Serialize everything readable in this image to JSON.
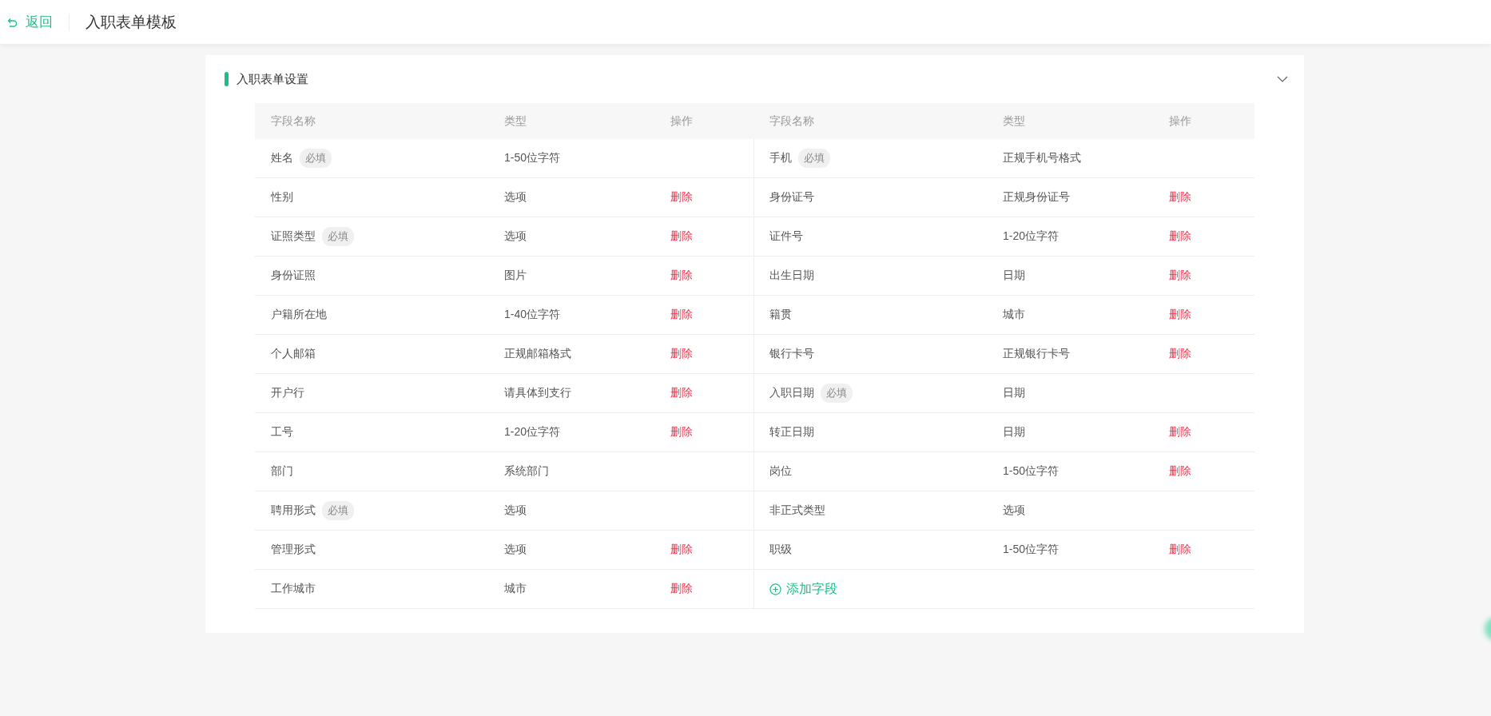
{
  "header": {
    "back": "返回",
    "title": "入职表单模板"
  },
  "section": {
    "title": "入职表单设置",
    "expanded": true
  },
  "table": {
    "columns": [
      "字段名称",
      "类型",
      "操作",
      "字段名称",
      "类型",
      "操作"
    ],
    "rows": [
      {
        "left": {
          "name": "姓名",
          "tag": "必填",
          "type": "1-50位字符"
        },
        "right": {
          "name": "手机",
          "tag": "必填",
          "type": "正规手机号格式"
        }
      },
      {
        "left": {
          "name": "性别",
          "type": "选项",
          "action": "删除"
        },
        "right": {
          "name": "身份证号",
          "type": "正规身份证号",
          "action": "删除"
        }
      },
      {
        "left": {
          "name": "证照类型",
          "tag": "必填",
          "type": "选项",
          "action": "删除"
        },
        "right": {
          "name": "证件号",
          "type": "1-20位字符",
          "action": "删除"
        }
      },
      {
        "left": {
          "name": "身份证照",
          "type": "图片",
          "action": "删除"
        },
        "right": {
          "name": "出生日期",
          "type": "日期",
          "action": "删除"
        }
      },
      {
        "left": {
          "name": "户籍所在地",
          "type": "1-40位字符",
          "action": "删除"
        },
        "right": {
          "name": "籍贯",
          "type": "城市",
          "action": "删除"
        }
      },
      {
        "left": {
          "name": "个人邮箱",
          "type": "正规邮箱格式",
          "action": "删除"
        },
        "right": {
          "name": "银行卡号",
          "type": "正规银行卡号",
          "action": "删除"
        }
      },
      {
        "left": {
          "name": "开户行",
          "type": "请具体到支行",
          "action": "删除"
        },
        "right": {
          "name": "入职日期",
          "tag": "必填",
          "type": "日期"
        }
      },
      {
        "left": {
          "name": "工号",
          "type": "1-20位字符",
          "action": "删除"
        },
        "right": {
          "name": "转正日期",
          "type": "日期",
          "action": "删除"
        }
      },
      {
        "left": {
          "name": "部门",
          "type": "系统部门"
        },
        "right": {
          "name": "岗位",
          "type": "1-50位字符",
          "action": "删除"
        }
      },
      {
        "left": {
          "name": "聘用形式",
          "tag": "必填",
          "type": "选项"
        },
        "right": {
          "name": "非正式类型",
          "type": "选项"
        }
      },
      {
        "left": {
          "name": "管理形式",
          "type": "选项",
          "action": "删除"
        },
        "right": {
          "name": "职级",
          "type": "1-50位字符",
          "action": "删除"
        }
      },
      {
        "left": {
          "name": "工作城市",
          "type": "城市",
          "action": "删除"
        },
        "add_field": "添加字段"
      }
    ]
  }
}
